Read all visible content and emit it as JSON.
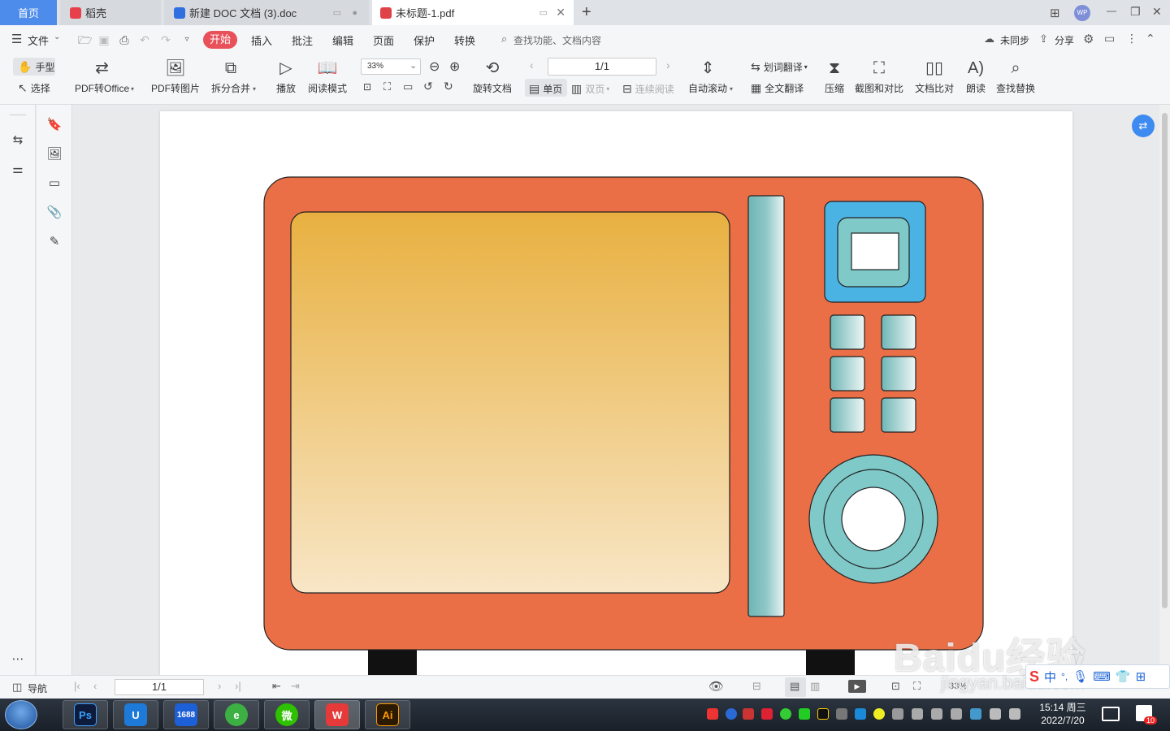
{
  "tabs": {
    "home": "首页",
    "daoke": "稻壳",
    "doc": "新建 DOC 文档 (3).doc",
    "pdf": "未标题-1.pdf",
    "add": "+"
  },
  "window": {
    "avatar": "WP",
    "minimize": "—",
    "restore": "❐",
    "close": "✕"
  },
  "menu": {
    "file": "文件",
    "start": "开始",
    "insert": "插入",
    "annotate": "批注",
    "edit": "编辑",
    "page": "页面",
    "protect": "保护",
    "convert": "转换",
    "search": "查找功能、文档内容",
    "sync": "未同步",
    "share": "分享"
  },
  "ribbon": {
    "hand": "手型",
    "select": "选择",
    "pdf_to_office": "PDF转Office",
    "pdf_to_image": "PDF转图片",
    "split_merge": "拆分合并",
    "play": "播放",
    "read_mode": "阅读模式",
    "zoom": "33%",
    "rotate_doc": "旋转文档",
    "page_num": "1/1",
    "single": "单页",
    "double": "双页",
    "continuous": "连续阅读",
    "auto_scroll": "自动滚动",
    "word_translate": "划词翻译",
    "full_translate": "全文翻译",
    "compress": "压缩",
    "screenshot_compare": "截图和对比",
    "doc_compare": "文档比对",
    "read_aloud": "朗读",
    "find_replace": "查找替换"
  },
  "status": {
    "nav": "导航",
    "page": "1/1",
    "zoom": "33%"
  },
  "taskbar": {
    "apps": [
      "Ps",
      "U",
      "1688",
      "e",
      "微",
      "W",
      "Ai"
    ],
    "time": "15:14 周三",
    "date": "2022/7/20",
    "badge": "10"
  },
  "ime": {
    "lang": "中",
    "punct": "°,"
  },
  "watermark": {
    "brand": "Baidu经验",
    "url": "jingyan.baidu.com"
  },
  "colors": {
    "accent": "#4e8cec",
    "start_button": "#e8505a",
    "microwave_body": "#ea6f47",
    "window_top": "#e8b040",
    "window_bottom": "#f8e6c6",
    "teal": "#7fc9c9",
    "panel_blue": "#4ab3e4"
  }
}
